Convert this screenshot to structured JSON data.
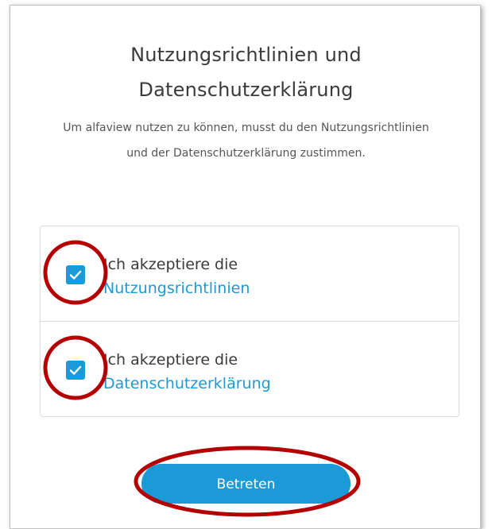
{
  "dialog": {
    "title_line1": "Nutzungsrichtlinien und",
    "title_line2": "Datenschutzerklärung",
    "subtitle": "Um alfaview nutzen zu können, musst du den Nutzungsrichtlinien und der Datenschutzerklärung zustimmen.",
    "consents": [
      {
        "text": "Ich akzeptiere die",
        "link": "Nutzungsrichtlinien",
        "checked": true
      },
      {
        "text": "Ich akzeptiere die",
        "link": "Datenschutzerklärung",
        "checked": true
      }
    ],
    "submit_label": "Betreten"
  },
  "colors": {
    "accent": "#1a9ad6",
    "annotation": "#b30000",
    "text": "#3a3a3a",
    "muted_text": "#555555",
    "border": "#dcdcdc"
  },
  "icons": {
    "checkbox_check": "check-icon"
  }
}
